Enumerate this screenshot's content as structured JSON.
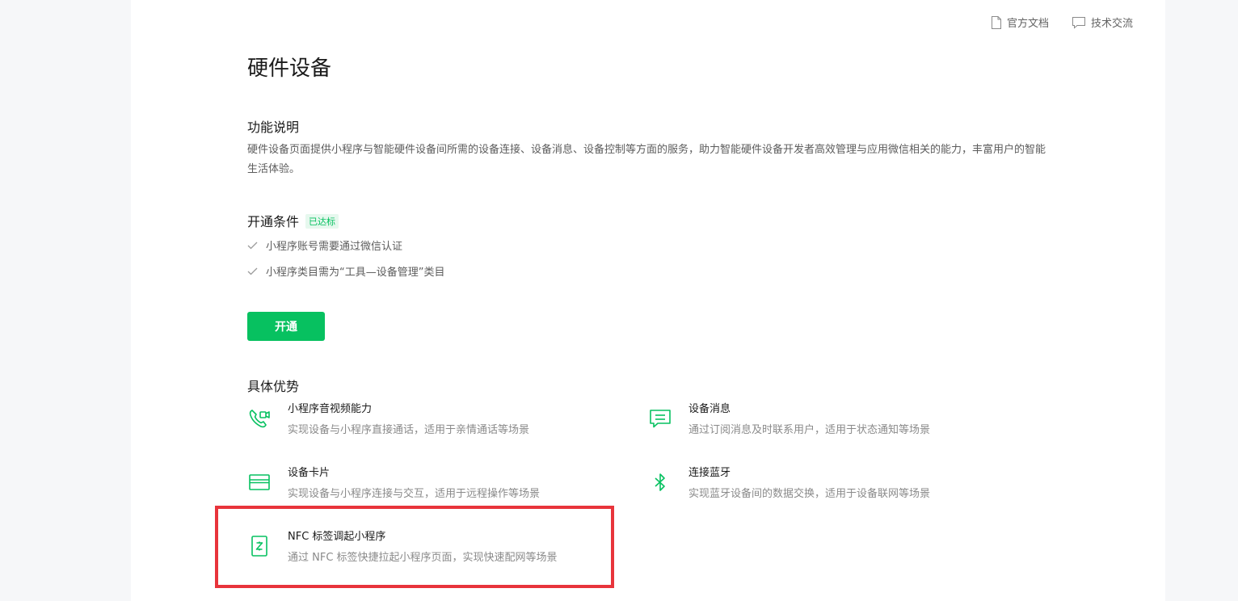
{
  "toplinks": {
    "docs": "官方文档",
    "community": "技术交流"
  },
  "page": {
    "title": "硬件设备"
  },
  "function": {
    "title": "功能说明",
    "description": "硬件设备页面提供小程序与智能硬件设备间所需的设备连接、设备消息、设备控制等方面的服务，助力智能硬件设备开发者高效管理与应用微信相关的能力，丰富用户的智能生活体验。"
  },
  "conditions": {
    "title": "开通条件",
    "badge": "已达标",
    "items": [
      "小程序账号需要通过微信认证",
      "小程序类目需为“工具—设备管理”类目"
    ]
  },
  "actions": {
    "open_label": "开通"
  },
  "advantages": {
    "title": "具体优势",
    "items": [
      {
        "icon": "video-call-icon",
        "name": "小程序音视频能力",
        "desc": "实现设备与小程序直接通话，适用于亲情通话等场景"
      },
      {
        "icon": "message-icon",
        "name": "设备消息",
        "desc": "通过订阅消息及时联系用户，适用于状态通知等场景"
      },
      {
        "icon": "card-icon",
        "name": "设备卡片",
        "desc": "实现设备与小程序连接与交互，适用于远程操作等场景"
      },
      {
        "icon": "bluetooth-icon",
        "name": "连接蓝牙",
        "desc": "实现蓝牙设备间的数据交换，适用于设备联网等场景"
      },
      {
        "icon": "nfc-icon",
        "name": "NFC 标签调起小程序",
        "desc": "通过 NFC 标签快捷拉起小程序页面，实现快速配网等场景"
      }
    ]
  },
  "colors": {
    "accent": "#07c160",
    "highlight": "#e8343b"
  }
}
